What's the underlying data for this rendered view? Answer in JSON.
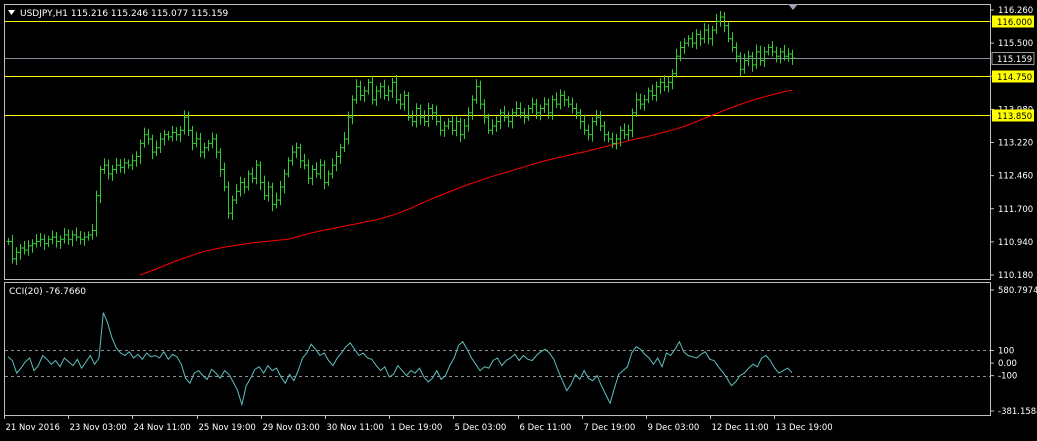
{
  "header": {
    "symbol_line": "USDJPY,H1  115.216 115.246 115.077 115.159",
    "collapse_icon": "triangle-down-icon"
  },
  "indicator": {
    "label": "CCI(20) -76.7660"
  },
  "colors": {
    "background": "#000000",
    "price_bars": "#32cd32",
    "moving_average": "#ff0000",
    "horizontal_lines": "#ffff00",
    "bid_line": "#8c8ca0",
    "cci_line": "#5fbfbf",
    "grid": "#c0c0c0"
  },
  "chart_data": [
    {
      "type": "line",
      "subtype": "bar-ohlc",
      "title": "USDJPY,H1",
      "ylim": [
        110.18,
        116.26
      ],
      "y_ticks": [
        "116.260",
        "115.500",
        "114.740",
        "113.980",
        "113.220",
        "112.460",
        "111.700",
        "110.940",
        "110.180"
      ],
      "horizontal_levels": [
        {
          "value": 116.0,
          "label": "116.000",
          "highlight": true
        },
        {
          "value": 114.75,
          "label": "114.750",
          "highlight": true
        },
        {
          "value": 113.85,
          "label": "113.850",
          "highlight": true
        },
        {
          "value": 115.159,
          "label": "115.159",
          "highlight": false
        }
      ],
      "x_labels": [
        "21 Nov 2016",
        "23 Nov 03:00",
        "24 Nov 11:00",
        "25 Nov 19:00",
        "29 Nov 03:00",
        "30 Nov 11:00",
        "1 Dec 19:00",
        "5 Dec 03:00",
        "6 Dec 11:00",
        "7 Dec 19:00",
        "9 Dec 03:00",
        "12 Dec 11:00",
        "13 Dec 19:00"
      ],
      "series": [
        {
          "kind": "close",
          "values": [
            110.95,
            110.55,
            110.7,
            110.8,
            110.75,
            110.85,
            110.9,
            110.95,
            111.0,
            110.9,
            111.0,
            111.05,
            110.95,
            111.0,
            111.1,
            111.0,
            111.1,
            111.05,
            111.0,
            111.05,
            111.1,
            111.2,
            112.0,
            112.6,
            112.7,
            112.5,
            112.6,
            112.7,
            112.65,
            112.75,
            112.7,
            112.8,
            112.9,
            113.2,
            113.4,
            113.3,
            113.0,
            113.1,
            113.3,
            113.4,
            113.35,
            113.45,
            113.4,
            113.5,
            113.8,
            113.5,
            113.2,
            113.3,
            113.0,
            113.1,
            113.2,
            113.3,
            113.0,
            112.6,
            112.2,
            111.6,
            111.9,
            112.1,
            112.3,
            112.2,
            112.5,
            112.4,
            112.7,
            112.3,
            112.0,
            112.2,
            111.8,
            111.9,
            112.2,
            112.5,
            112.8,
            113.0,
            113.1,
            112.8,
            112.7,
            112.4,
            112.6,
            112.5,
            112.7,
            112.3,
            112.5,
            112.7,
            112.9,
            113.1,
            113.3,
            113.8,
            114.2,
            114.5,
            114.3,
            114.4,
            114.6,
            114.2,
            114.4,
            114.5,
            114.3,
            114.4,
            114.6,
            114.2,
            114.1,
            114.3,
            113.8,
            113.7,
            114.0,
            113.8,
            113.7,
            114.0,
            113.9,
            113.7,
            113.5,
            113.6,
            113.7,
            113.5,
            113.7,
            113.4,
            113.6,
            113.9,
            114.2,
            114.5,
            114.1,
            113.8,
            113.5,
            113.6,
            113.7,
            113.9,
            113.8,
            113.7,
            113.9,
            114.0,
            113.9,
            113.8,
            114.0,
            114.1,
            113.9,
            114.0,
            114.1,
            113.9,
            114.2,
            114.1,
            114.3,
            114.2,
            114.1,
            114.0,
            113.9,
            113.7,
            113.5,
            113.4,
            113.7,
            113.8,
            113.6,
            113.4,
            113.3,
            113.2,
            113.3,
            113.5,
            113.4,
            113.5,
            113.9,
            114.2,
            114.1,
            114.2,
            114.4,
            114.3,
            114.5,
            114.6,
            114.5,
            114.6,
            114.8,
            115.2,
            115.4,
            115.5,
            115.6,
            115.5,
            115.7,
            115.6,
            115.8,
            115.6,
            115.8,
            116.0,
            116.1,
            115.9,
            115.6,
            115.4,
            115.2,
            114.9,
            115.1,
            115.2,
            115.0,
            115.3,
            115.1,
            115.3,
            115.4,
            115.3,
            115.2,
            115.3,
            115.2,
            115.25,
            115.16
          ]
        },
        {
          "kind": "moving-average",
          "values": [
            110.18,
            110.25,
            110.33,
            110.41,
            110.49,
            110.56,
            110.63,
            110.7,
            110.75,
            110.79,
            110.83,
            110.86,
            110.89,
            110.92,
            110.94,
            110.96,
            110.98,
            111.0,
            111.05,
            111.11,
            111.16,
            111.2,
            111.24,
            111.28,
            111.32,
            111.36,
            111.4,
            111.44,
            111.49,
            111.55,
            111.62,
            111.7,
            111.79,
            111.88,
            111.96,
            112.04,
            112.12,
            112.2,
            112.27,
            112.34,
            112.41,
            112.47,
            112.53,
            112.59,
            112.65,
            112.71,
            112.77,
            112.82,
            112.87,
            112.91,
            112.96,
            113.0,
            113.05,
            113.1,
            113.15,
            113.2,
            113.25,
            113.3,
            113.34,
            113.39,
            113.44,
            113.49,
            113.55,
            113.62,
            113.7,
            113.78,
            113.86,
            113.94,
            114.02,
            114.09,
            114.16,
            114.22,
            114.28,
            114.33,
            114.38,
            114.42
          ]
        }
      ]
    },
    {
      "type": "line",
      "title": "CCI(20) -76.7660",
      "ylim": [
        -381.1584,
        580.7974
      ],
      "y_ticks": [
        "580.7974",
        "100",
        "0.00",
        "-100",
        "-381.1584"
      ],
      "levels": [
        100,
        -100
      ],
      "series": [
        {
          "kind": "cci",
          "values": [
            50,
            20,
            -80,
            -40,
            10,
            40,
            -60,
            -20,
            60,
            30,
            -10,
            20,
            -30,
            40,
            10,
            -20,
            30,
            -40,
            10,
            60,
            -10,
            40,
            400,
            320,
            200,
            120,
            80,
            60,
            90,
            40,
            70,
            30,
            80,
            50,
            60,
            40,
            90,
            30,
            70,
            50,
            -10,
            -120,
            -160,
            -80,
            -60,
            -100,
            -130,
            -50,
            -80,
            -120,
            -60,
            -90,
            -150,
            -220,
            -330,
            -180,
            -120,
            -50,
            -30,
            -80,
            -20,
            -60,
            -40,
            -110,
            -160,
            -90,
            -140,
            -60,
            40,
            80,
            150,
            110,
            60,
            80,
            20,
            -20,
            40,
            80,
            130,
            160,
            110,
            60,
            80,
            40,
            30,
            -20,
            -60,
            -30,
            -110,
            -90,
            -20,
            -60,
            -100,
            -60,
            -80,
            -40,
            -110,
            -150,
            -120,
            -60,
            -130,
            -100,
            -20,
            40,
            140,
            170,
            110,
            40,
            -10,
            -60,
            -30,
            -40,
            20,
            40,
            -20,
            20,
            40,
            70,
            20,
            60,
            30,
            20,
            60,
            90,
            110,
            80,
            30,
            -60,
            -140,
            -220,
            -170,
            -90,
            -130,
            -60,
            -120,
            -140,
            -100,
            -180,
            -250,
            -320,
            -200,
            -90,
            -60,
            -30,
            80,
            130,
            110,
            70,
            40,
            -10,
            40,
            -30,
            80,
            60,
            110,
            170,
            90,
            60,
            50,
            40,
            70,
            90,
            30,
            20,
            -30,
            -70,
            -120,
            -180,
            -150,
            -100,
            -80,
            -40,
            -10,
            -30,
            40,
            60,
            20,
            -40,
            -80,
            -60,
            -40,
            -77
          ]
        }
      ]
    }
  ]
}
